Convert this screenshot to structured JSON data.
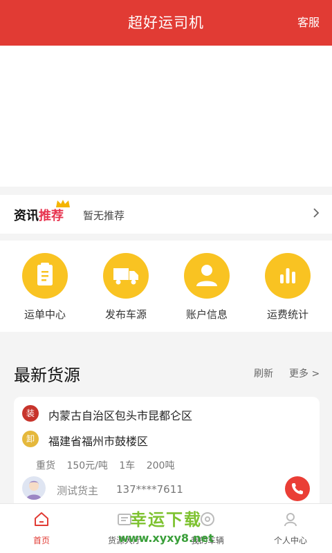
{
  "header": {
    "title": "超好运司机",
    "service_label": "客服"
  },
  "news": {
    "brand_part1": "资讯",
    "brand_part2": "推荐",
    "text": "暂无推荐"
  },
  "menu": [
    {
      "label": "运单中心",
      "icon": "clipboard-icon"
    },
    {
      "label": "发布车源",
      "icon": "truck-icon"
    },
    {
      "label": "账户信息",
      "icon": "user-icon"
    },
    {
      "label": "运费统计",
      "icon": "bar-chart-icon"
    }
  ],
  "cargo": {
    "heading": "最新货源",
    "refresh_label": "刷新",
    "more_label": "更多 >",
    "item": {
      "load_badge": "装",
      "unload_badge": "卸",
      "from": "内蒙古自治区包头市昆都仑区",
      "to": "福建省福州市鼓楼区",
      "cargo_type": "重货",
      "price": "150元/吨",
      "trucks": "1车",
      "weight": "200吨",
      "owner_name": "测试货主",
      "owner_phone": "137****7611"
    }
  },
  "tabbar": [
    {
      "label": "首页",
      "active": true
    },
    {
      "label": "货源大厅",
      "active": false
    },
    {
      "label": "我的车辆",
      "active": false
    },
    {
      "label": "个人中心",
      "active": false
    }
  ],
  "watermark": {
    "cn": "幸运下载",
    "url": "www.xyxy8.net"
  },
  "colors": {
    "primary": "#e13b34",
    "accent": "#f9c322",
    "badge_load": "#c7342c",
    "badge_unload": "#e5b83c"
  }
}
